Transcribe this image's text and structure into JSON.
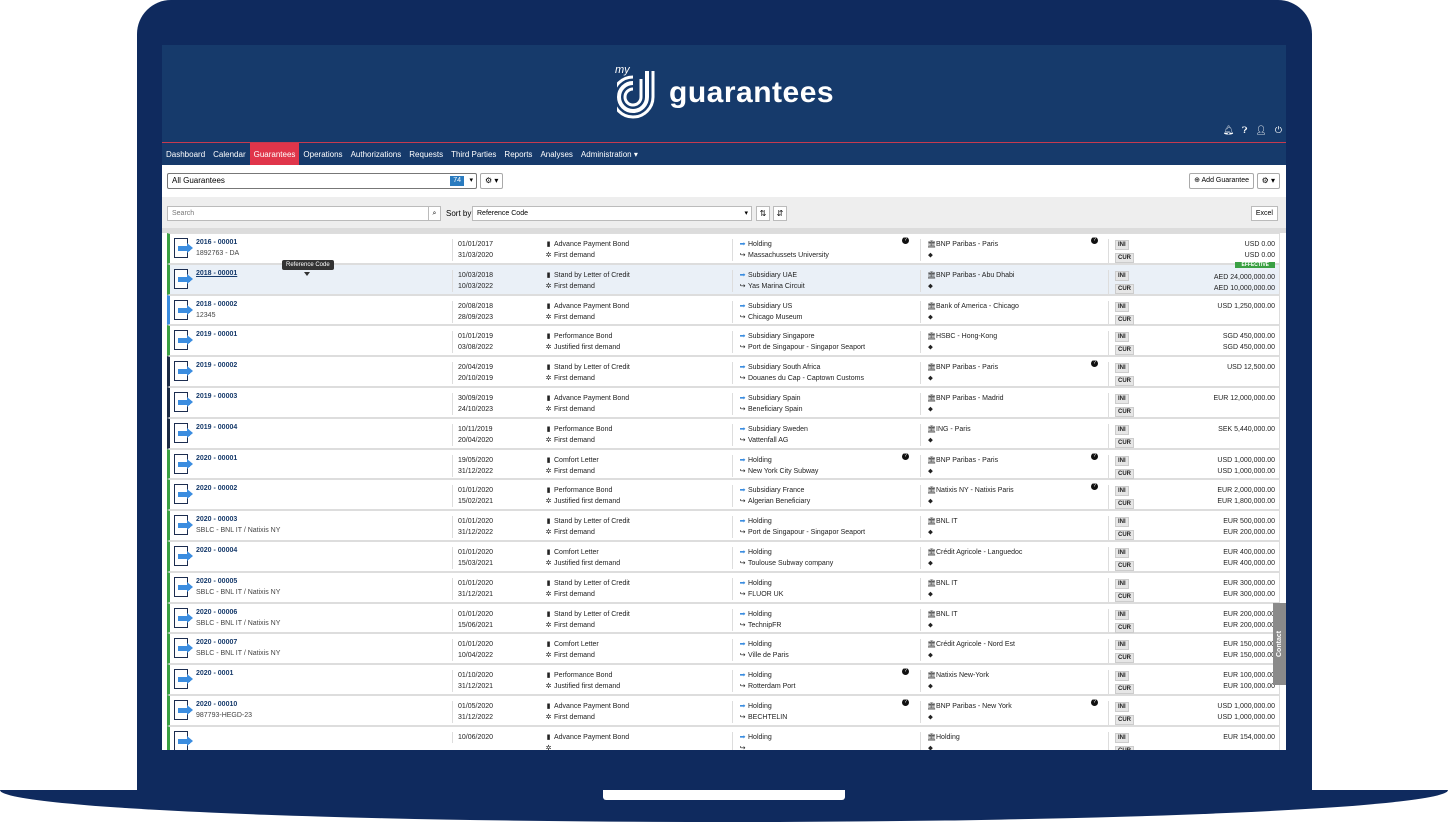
{
  "app": {
    "logo_prefix": "my",
    "logo_text": "guarantees"
  },
  "header_icons": [
    "bell-icon",
    "help-icon",
    "user-icon",
    "power-icon"
  ],
  "menu": [
    {
      "label": "Dashboard"
    },
    {
      "label": "Calendar"
    },
    {
      "label": "Guarantees",
      "active": true
    },
    {
      "label": "Operations"
    },
    {
      "label": "Authorizations"
    },
    {
      "label": "Requests"
    },
    {
      "label": "Third Parties"
    },
    {
      "label": "Reports"
    },
    {
      "label": "Analyses"
    },
    {
      "label": "Administration ▾"
    }
  ],
  "filter": {
    "selected": "All Guarantees",
    "count": "74",
    "add_label": "Add Guarantee"
  },
  "search": {
    "placeholder": "Search",
    "sort_label": "Sort by",
    "sort_value": "Reference Code",
    "excel_label": "Excel"
  },
  "tooltip": "Reference Code",
  "contact_label": "Contact",
  "rows": [
    {
      "ref": "2016 - 00001",
      "sub": "1892763 - DA",
      "d1": "01/01/2017",
      "d2": "31/03/2020",
      "type": "Advance Payment Bond",
      "demand": "First demand",
      "party": "Holding",
      "benef": "Massachussets University",
      "bank": "BNP Paribas - Paris",
      "a1": "USD 0.00",
      "a2": "USD 0.00",
      "q4": true,
      "q5": true,
      "color": "green"
    },
    {
      "ref": "2018 - 00001",
      "sub": "",
      "d1": "10/03/2018",
      "d2": "10/03/2022",
      "type": "Stand by Letter of Credit",
      "demand": "First demand",
      "party": "Subsidiary UAE",
      "benef": "Yas Marina Circuit",
      "bank": "BNP Paribas - Abu Dhabi",
      "a1": "AED 24,000,000.00",
      "a2": "AED 10,000,000.00",
      "effective": "EFFECTIVE",
      "hl": true,
      "color": "green"
    },
    {
      "ref": "2018 - 00002",
      "sub": "12345",
      "d1": "20/08/2018",
      "d2": "28/09/2023",
      "type": "Advance Payment Bond",
      "demand": "First demand",
      "party": "Subsidiary US",
      "benef": "Chicago Museum",
      "bank": "Bank of America - Chicago",
      "a1": "USD 1,250,000.00",
      "a2": "",
      "color": "blue"
    },
    {
      "ref": "2019 - 00001",
      "sub": "",
      "d1": "01/01/2019",
      "d2": "03/08/2022",
      "type": "Performance Bond",
      "demand": "Justified first demand",
      "party": "Subsidiary Singapore",
      "benef": "Port de Singapour - Singapor Seaport",
      "bank": "HSBC - Hong-Kong",
      "a1": "SGD 450,000.00",
      "a2": "SGD 450,000.00",
      "color": "green"
    },
    {
      "ref": "2019 - 00002",
      "sub": "",
      "d1": "20/04/2019",
      "d2": "20/10/2019",
      "type": "Stand by Letter of Credit",
      "demand": "First demand",
      "party": "Subsidiary South Africa",
      "benef": "Douanes du Cap - Captown Customs",
      "bank": "BNP Paribas - Paris",
      "a1": "USD 12,500.00",
      "a2": "",
      "q5": true,
      "color": "dark"
    },
    {
      "ref": "2019 - 00003",
      "sub": "",
      "d1": "30/09/2019",
      "d2": "24/10/2023",
      "type": "Advance Payment Bond",
      "demand": "First demand",
      "party": "Subsidiary Spain",
      "benef": "Beneficiary Spain",
      "bank": "BNP Paribas - Madrid",
      "a1": "EUR 12,000,000.00",
      "a2": "",
      "color": "dark"
    },
    {
      "ref": "2019 - 00004",
      "sub": "",
      "d1": "10/11/2019",
      "d2": "20/04/2020",
      "type": "Performance Bond",
      "demand": "First demand",
      "party": "Subsidiary Sweden",
      "benef": "Vattenfall AG",
      "bank": "ING - Paris",
      "a1": "SEK 5,440,000.00",
      "a2": "",
      "color": "dark"
    },
    {
      "ref": "2020 - 00001",
      "sub": "",
      "d1": "19/05/2020",
      "d2": "31/12/2022",
      "type": "Comfort Letter",
      "demand": "First demand",
      "party": "Holding",
      "benef": "New York City Subway",
      "bank": "BNP Paribas - Paris",
      "a1": "USD 1,000,000.00",
      "a2": "USD 1,000,000.00",
      "q4": true,
      "q5": true,
      "color": "green"
    },
    {
      "ref": "2020 - 00002",
      "sub": "",
      "d1": "01/01/2020",
      "d2": "15/02/2021",
      "type": "Performance Bond",
      "demand": "Justified first demand",
      "party": "Subsidiary France",
      "benef": "Algerian Beneficiary",
      "bank": "Natixis NY - Natixis Paris",
      "a1": "EUR 2,000,000.00",
      "a2": "EUR 1,800,000.00",
      "q5": true,
      "color": "green"
    },
    {
      "ref": "2020 - 00003",
      "sub": "SBLC - BNL IT / Natixis NY",
      "d1": "01/01/2020",
      "d2": "31/12/2022",
      "type": "Stand by Letter of Credit",
      "demand": "First demand",
      "party": "Holding",
      "benef": "Port de Singapour - Singapor Seaport",
      "bank": "BNL IT",
      "a1": "EUR 500,000.00",
      "a2": "EUR 200,000.00",
      "color": "green"
    },
    {
      "ref": "2020 - 00004",
      "sub": "",
      "d1": "01/01/2020",
      "d2": "15/03/2021",
      "type": "Comfort Letter",
      "demand": "Justified first demand",
      "party": "Holding",
      "benef": "Toulouse Subway company",
      "bank": "Crédit Agricole - Languedoc",
      "a1": "EUR 400,000.00",
      "a2": "EUR 400,000.00",
      "color": "green"
    },
    {
      "ref": "2020 - 00005",
      "sub": "SBLC - BNL IT / Natixis NY",
      "d1": "01/01/2020",
      "d2": "31/12/2021",
      "type": "Stand by Letter of Credit",
      "demand": "First demand",
      "party": "Holding",
      "benef": "FLUOR UK",
      "bank": "BNL IT",
      "a1": "EUR 300,000.00",
      "a2": "EUR 300,000.00",
      "color": "green"
    },
    {
      "ref": "2020 - 00006",
      "sub": "SBLC - BNL IT / Natixis NY",
      "d1": "01/01/2020",
      "d2": "15/06/2021",
      "type": "Stand by Letter of Credit",
      "demand": "First demand",
      "party": "Holding",
      "benef": "TechnipFR",
      "bank": "BNL IT",
      "a1": "EUR 200,000.00",
      "a2": "EUR 200,000.00",
      "color": "green"
    },
    {
      "ref": "2020 - 00007",
      "sub": "SBLC - BNL IT / Natixis NY",
      "d1": "01/01/2020",
      "d2": "10/04/2022",
      "type": "Comfort Letter",
      "demand": "First demand",
      "party": "Holding",
      "benef": "Ville de Paris",
      "bank": "Crédit Agricole - Nord Est",
      "a1": "EUR 150,000.00",
      "a2": "EUR 150,000.00",
      "color": "green"
    },
    {
      "ref": "2020 - 0001",
      "sub": "",
      "d1": "01/10/2020",
      "d2": "31/12/2021",
      "type": "Performance Bond",
      "demand": "Justified first demand",
      "party": "Holding",
      "benef": "Rotterdam Port",
      "bank": "Natixis New-York",
      "a1": "EUR 100,000.00",
      "a2": "EUR 100,000.00",
      "q4": true,
      "color": "green"
    },
    {
      "ref": "2020 - 00010",
      "sub": "987793-HEGD-23",
      "d1": "01/05/2020",
      "d2": "31/12/2022",
      "type": "Advance Payment Bond",
      "demand": "First demand",
      "party": "Holding",
      "benef": "BECHTELIN",
      "bank": "BNP Paribas - New York",
      "a1": "USD 1,000,000.00",
      "a2": "USD 1,000,000.00",
      "q4": true,
      "q5": true,
      "color": "green"
    },
    {
      "ref": "",
      "sub": "",
      "d1": "10/06/2020",
      "d2": "",
      "type": "Advance Payment Bond",
      "demand": "",
      "party": "Holding",
      "benef": "",
      "bank": "Holding",
      "a1": "EUR 154,000.00",
      "a2": "",
      "color": "green"
    }
  ],
  "tags": {
    "ini": "INI",
    "cur": "CUR"
  }
}
